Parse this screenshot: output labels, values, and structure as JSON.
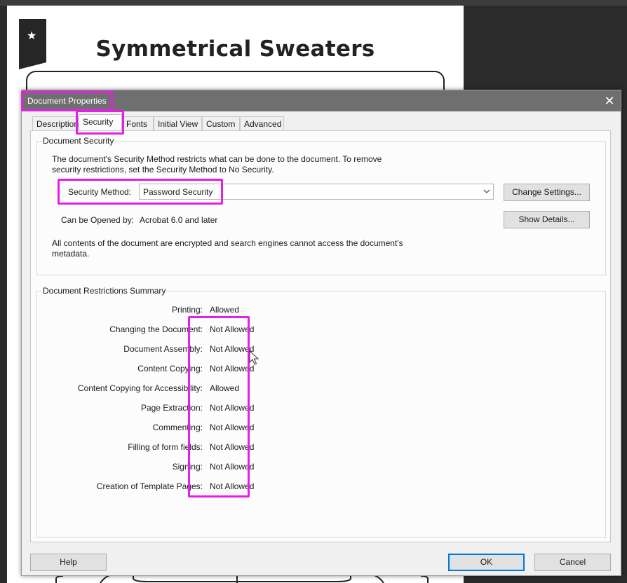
{
  "pdf": {
    "title": "Symmetrical Sweaters",
    "icon": "star-icon"
  },
  "dialog": {
    "title": "Document Properties",
    "close_icon": "close-icon",
    "tabs": [
      {
        "label": "Description",
        "active": false
      },
      {
        "label": "Security",
        "active": true
      },
      {
        "label": "Fonts",
        "active": false
      },
      {
        "label": "Initial View",
        "active": false
      },
      {
        "label": "Custom",
        "active": false
      },
      {
        "label": "Advanced",
        "active": false
      }
    ],
    "security": {
      "group_title": "Document Security",
      "intro_line1": "The document's Security Method restricts what can be done to the document. To remove",
      "intro_line2": "security restrictions, set the Security Method to No Security.",
      "method_label": "Security Method:",
      "method_value": "Password Security",
      "change_settings_label": "Change Settings...",
      "opened_by_label": "Can be Opened by:",
      "opened_by_value": "Acrobat 6.0 and later",
      "show_details_label": "Show Details...",
      "note_line1": "All contents of the document are encrypted and search engines cannot access the document's",
      "note_line2": "metadata."
    },
    "restrictions": {
      "group_title": "Document Restrictions Summary",
      "rows": [
        {
          "label": "Printing:",
          "value": "Allowed"
        },
        {
          "label": "Changing the Document:",
          "value": "Not Allowed"
        },
        {
          "label": "Document Assembly:",
          "value": "Not Allowed"
        },
        {
          "label": "Content Copying:",
          "value": "Not Allowed"
        },
        {
          "label": "Content Copying for Accessibility:",
          "value": "Allowed"
        },
        {
          "label": "Page Extraction:",
          "value": "Not Allowed"
        },
        {
          "label": "Commenting:",
          "value": "Not Allowed"
        },
        {
          "label": "Filling of form fields:",
          "value": "Not Allowed"
        },
        {
          "label": "Signing:",
          "value": "Not Allowed"
        },
        {
          "label": "Creation of Template Pages:",
          "value": "Not Allowed"
        }
      ]
    },
    "buttons": {
      "help": "Help",
      "ok": "OK",
      "cancel": "Cancel"
    }
  },
  "colors": {
    "highlight": "#e51fe5",
    "titlebar": "#6f6f6f",
    "default_button_border": "#0078d7"
  }
}
